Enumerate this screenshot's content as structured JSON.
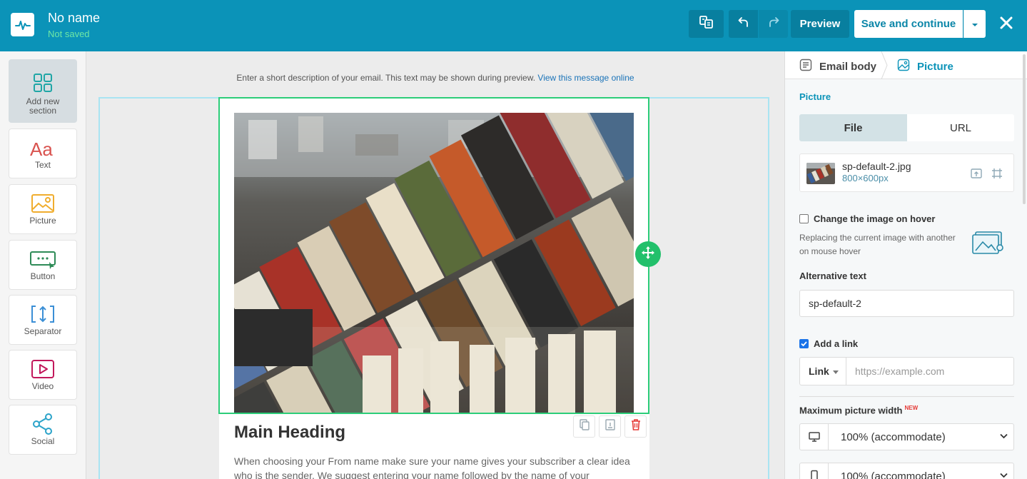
{
  "header": {
    "title": "No name",
    "status": "Not saved",
    "preview_label": "Preview",
    "save_label": "Save and continue"
  },
  "sidebar": {
    "items": [
      {
        "label": "Add new section",
        "icon": "grid-icon"
      },
      {
        "label": "Text",
        "icon": "text-icon"
      },
      {
        "label": "Picture",
        "icon": "picture-icon"
      },
      {
        "label": "Button",
        "icon": "button-icon"
      },
      {
        "label": "Separator",
        "icon": "separator-icon"
      },
      {
        "label": "Video",
        "icon": "video-icon"
      },
      {
        "label": "Social",
        "icon": "share-icon"
      }
    ]
  },
  "canvas": {
    "preheader": "Enter a short description of your email. This text may be shown during preview.",
    "preheader_link": "View this message online",
    "heading": "Main Heading",
    "body_text": "When choosing your From name make sure your name gives your subscriber a clear idea who is the sender. We suggest entering your name followed by the name of your"
  },
  "panel": {
    "breadcrumb": {
      "parent": "Email body",
      "current": "Picture"
    },
    "section_title": "Picture",
    "source_tabs": {
      "file": "File",
      "url": "URL",
      "selected": "File"
    },
    "file": {
      "name": "sp-default-2.jpg",
      "dimensions": "800×600px"
    },
    "hover": {
      "label": "Change the image on hover",
      "checked": false,
      "description": "Replacing the current image with another on mouse hover"
    },
    "alt_text": {
      "label": "Alternative text",
      "value": "sp-default-2"
    },
    "link": {
      "label": "Add a link",
      "checked": true,
      "type": "Link",
      "placeholder": "https://example.com"
    },
    "max_width": {
      "label": "Maximum picture width",
      "badge": "NEW",
      "desktop_value": "100% (accommodate)",
      "mobile_value": "100% (accommodate)"
    }
  },
  "colors": {
    "header_bg": "#0b93b8",
    "accent": "#0b93b8",
    "selection_green": "#2ccd79",
    "section_outline": "#a9e4f2",
    "not_saved": "#6ee7a5"
  }
}
